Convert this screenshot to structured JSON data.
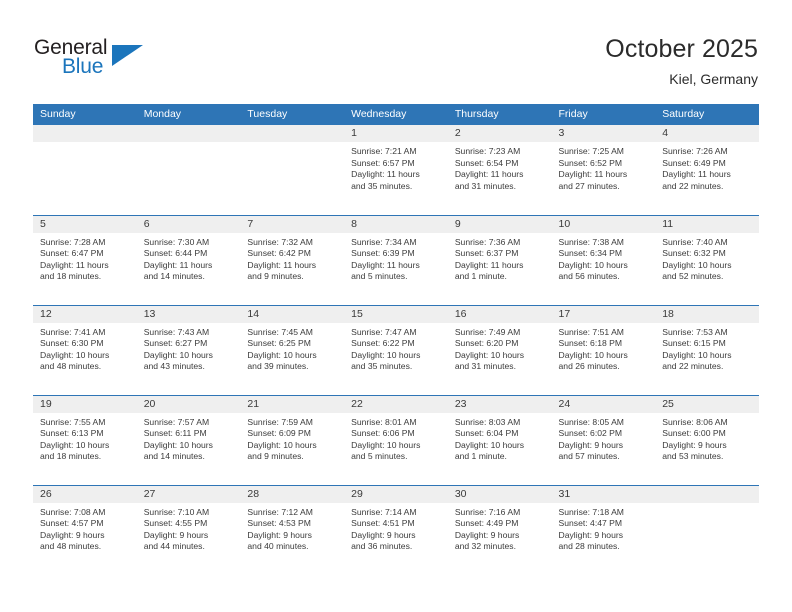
{
  "brand": {
    "word_one": "General",
    "word_two": "Blue",
    "triangle_icon": "triangle-icon",
    "accent_color": "#1b75bc"
  },
  "header": {
    "title": "October 2025",
    "subtitle": "Kiel, Germany"
  },
  "theme": {
    "header_row_bg": "#2e75b6",
    "daynum_band_bg": "#efefef",
    "grid_line": "#2e75b6",
    "text": "#3b3b3b"
  },
  "calendar": {
    "weekday_headers": [
      "Sunday",
      "Monday",
      "Tuesday",
      "Wednesday",
      "Thursday",
      "Friday",
      "Saturday"
    ],
    "weeks": [
      [
        {
          "day": "",
          "lines": [
            "",
            "",
            "",
            ""
          ]
        },
        {
          "day": "",
          "lines": [
            "",
            "",
            "",
            ""
          ]
        },
        {
          "day": "",
          "lines": [
            "",
            "",
            "",
            ""
          ]
        },
        {
          "day": "1",
          "lines": [
            "Sunrise: 7:21 AM",
            "Sunset: 6:57 PM",
            "Daylight: 11 hours",
            "and 35 minutes."
          ]
        },
        {
          "day": "2",
          "lines": [
            "Sunrise: 7:23 AM",
            "Sunset: 6:54 PM",
            "Daylight: 11 hours",
            "and 31 minutes."
          ]
        },
        {
          "day": "3",
          "lines": [
            "Sunrise: 7:25 AM",
            "Sunset: 6:52 PM",
            "Daylight: 11 hours",
            "and 27 minutes."
          ]
        },
        {
          "day": "4",
          "lines": [
            "Sunrise: 7:26 AM",
            "Sunset: 6:49 PM",
            "Daylight: 11 hours",
            "and 22 minutes."
          ]
        }
      ],
      [
        {
          "day": "5",
          "lines": [
            "Sunrise: 7:28 AM",
            "Sunset: 6:47 PM",
            "Daylight: 11 hours",
            "and 18 minutes."
          ]
        },
        {
          "day": "6",
          "lines": [
            "Sunrise: 7:30 AM",
            "Sunset: 6:44 PM",
            "Daylight: 11 hours",
            "and 14 minutes."
          ]
        },
        {
          "day": "7",
          "lines": [
            "Sunrise: 7:32 AM",
            "Sunset: 6:42 PM",
            "Daylight: 11 hours",
            "and 9 minutes."
          ]
        },
        {
          "day": "8",
          "lines": [
            "Sunrise: 7:34 AM",
            "Sunset: 6:39 PM",
            "Daylight: 11 hours",
            "and 5 minutes."
          ]
        },
        {
          "day": "9",
          "lines": [
            "Sunrise: 7:36 AM",
            "Sunset: 6:37 PM",
            "Daylight: 11 hours",
            "and 1 minute."
          ]
        },
        {
          "day": "10",
          "lines": [
            "Sunrise: 7:38 AM",
            "Sunset: 6:34 PM",
            "Daylight: 10 hours",
            "and 56 minutes."
          ]
        },
        {
          "day": "11",
          "lines": [
            "Sunrise: 7:40 AM",
            "Sunset: 6:32 PM",
            "Daylight: 10 hours",
            "and 52 minutes."
          ]
        }
      ],
      [
        {
          "day": "12",
          "lines": [
            "Sunrise: 7:41 AM",
            "Sunset: 6:30 PM",
            "Daylight: 10 hours",
            "and 48 minutes."
          ]
        },
        {
          "day": "13",
          "lines": [
            "Sunrise: 7:43 AM",
            "Sunset: 6:27 PM",
            "Daylight: 10 hours",
            "and 43 minutes."
          ]
        },
        {
          "day": "14",
          "lines": [
            "Sunrise: 7:45 AM",
            "Sunset: 6:25 PM",
            "Daylight: 10 hours",
            "and 39 minutes."
          ]
        },
        {
          "day": "15",
          "lines": [
            "Sunrise: 7:47 AM",
            "Sunset: 6:22 PM",
            "Daylight: 10 hours",
            "and 35 minutes."
          ]
        },
        {
          "day": "16",
          "lines": [
            "Sunrise: 7:49 AM",
            "Sunset: 6:20 PM",
            "Daylight: 10 hours",
            "and 31 minutes."
          ]
        },
        {
          "day": "17",
          "lines": [
            "Sunrise: 7:51 AM",
            "Sunset: 6:18 PM",
            "Daylight: 10 hours",
            "and 26 minutes."
          ]
        },
        {
          "day": "18",
          "lines": [
            "Sunrise: 7:53 AM",
            "Sunset: 6:15 PM",
            "Daylight: 10 hours",
            "and 22 minutes."
          ]
        }
      ],
      [
        {
          "day": "19",
          "lines": [
            "Sunrise: 7:55 AM",
            "Sunset: 6:13 PM",
            "Daylight: 10 hours",
            "and 18 minutes."
          ]
        },
        {
          "day": "20",
          "lines": [
            "Sunrise: 7:57 AM",
            "Sunset: 6:11 PM",
            "Daylight: 10 hours",
            "and 14 minutes."
          ]
        },
        {
          "day": "21",
          "lines": [
            "Sunrise: 7:59 AM",
            "Sunset: 6:09 PM",
            "Daylight: 10 hours",
            "and 9 minutes."
          ]
        },
        {
          "day": "22",
          "lines": [
            "Sunrise: 8:01 AM",
            "Sunset: 6:06 PM",
            "Daylight: 10 hours",
            "and 5 minutes."
          ]
        },
        {
          "day": "23",
          "lines": [
            "Sunrise: 8:03 AM",
            "Sunset: 6:04 PM",
            "Daylight: 10 hours",
            "and 1 minute."
          ]
        },
        {
          "day": "24",
          "lines": [
            "Sunrise: 8:05 AM",
            "Sunset: 6:02 PM",
            "Daylight: 9 hours",
            "and 57 minutes."
          ]
        },
        {
          "day": "25",
          "lines": [
            "Sunrise: 8:06 AM",
            "Sunset: 6:00 PM",
            "Daylight: 9 hours",
            "and 53 minutes."
          ]
        }
      ],
      [
        {
          "day": "26",
          "lines": [
            "Sunrise: 7:08 AM",
            "Sunset: 4:57 PM",
            "Daylight: 9 hours",
            "and 48 minutes."
          ]
        },
        {
          "day": "27",
          "lines": [
            "Sunrise: 7:10 AM",
            "Sunset: 4:55 PM",
            "Daylight: 9 hours",
            "and 44 minutes."
          ]
        },
        {
          "day": "28",
          "lines": [
            "Sunrise: 7:12 AM",
            "Sunset: 4:53 PM",
            "Daylight: 9 hours",
            "and 40 minutes."
          ]
        },
        {
          "day": "29",
          "lines": [
            "Sunrise: 7:14 AM",
            "Sunset: 4:51 PM",
            "Daylight: 9 hours",
            "and 36 minutes."
          ]
        },
        {
          "day": "30",
          "lines": [
            "Sunrise: 7:16 AM",
            "Sunset: 4:49 PM",
            "Daylight: 9 hours",
            "and 32 minutes."
          ]
        },
        {
          "day": "31",
          "lines": [
            "Sunrise: 7:18 AM",
            "Sunset: 4:47 PM",
            "Daylight: 9 hours",
            "and 28 minutes."
          ]
        },
        {
          "day": "",
          "lines": [
            "",
            "",
            "",
            ""
          ]
        }
      ]
    ]
  }
}
